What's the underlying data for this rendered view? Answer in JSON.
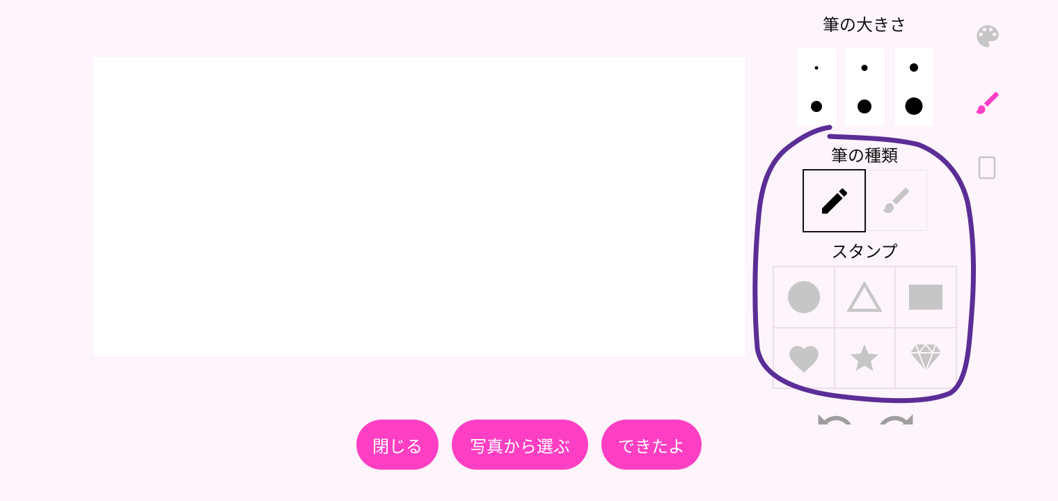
{
  "brush_size": {
    "title": "筆の大きさ"
  },
  "brush_type": {
    "title": "筆の種類",
    "options": [
      {
        "icon": "pencil-icon",
        "selected": true
      },
      {
        "icon": "paintbrush-icon",
        "selected": false
      }
    ]
  },
  "stamps": {
    "title": "スタンプ",
    "items": [
      "circle-icon",
      "triangle-icon",
      "rectangle-icon",
      "heart-icon",
      "star-icon",
      "diamond-icon"
    ]
  },
  "actions": {
    "close": "閉じる",
    "choose_photo": "写真から選ぶ",
    "done": "できたよ"
  },
  "sidebar": {
    "items": [
      "palette-icon",
      "brush-icon",
      "background-icon"
    ],
    "active": "brush-icon"
  },
  "colors": {
    "accent": "#ff3fc3",
    "background": "#fdf4fc",
    "disabled_icon": "#c6c6c6",
    "annotation": "#5b2d96"
  }
}
